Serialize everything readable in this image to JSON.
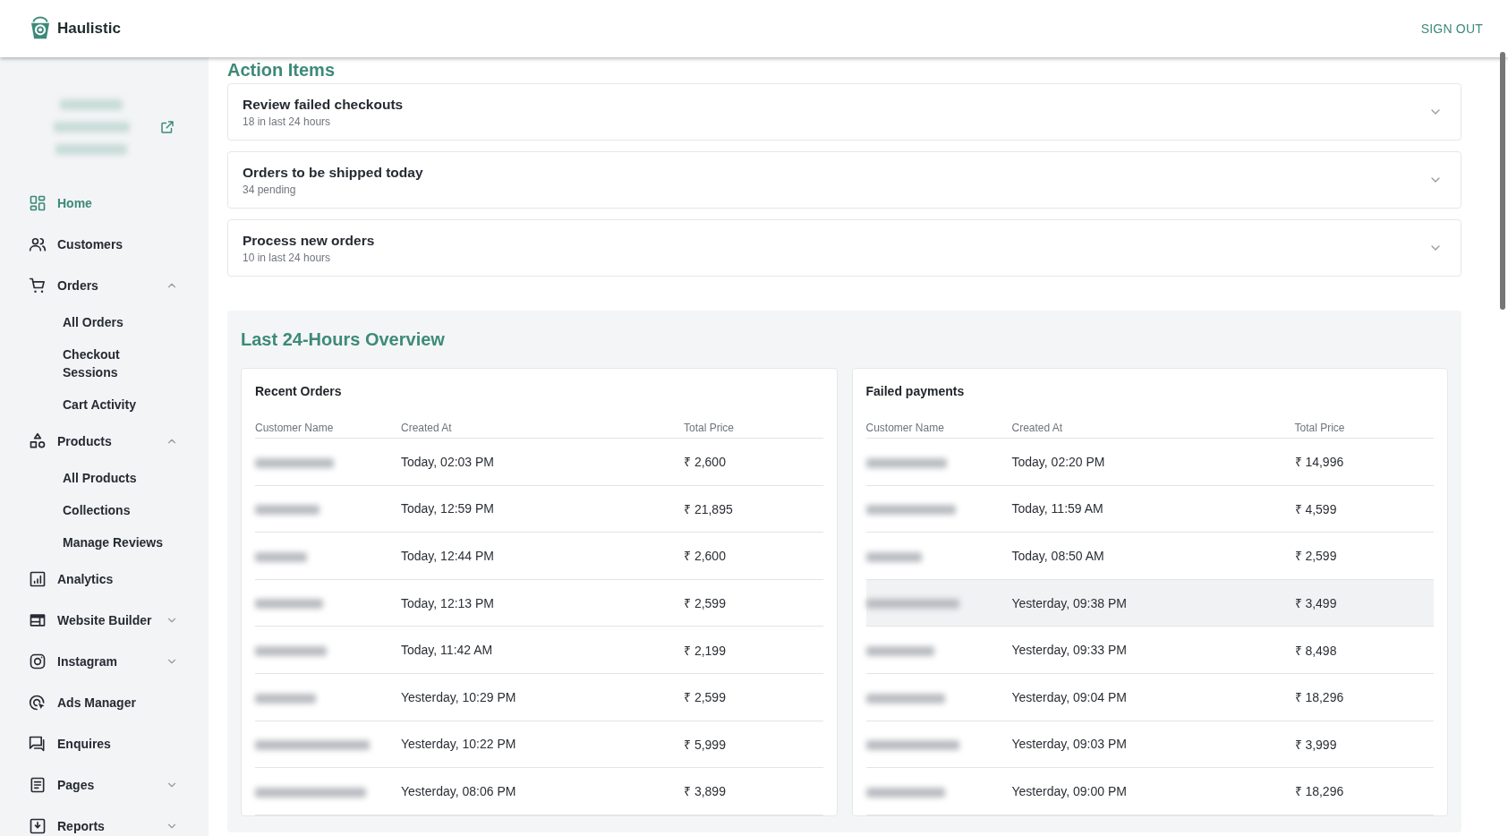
{
  "header": {
    "brand": "Haulistic",
    "sign_out": "SIGN OUT"
  },
  "sidebar": {
    "shop": {
      "kind": "blurred"
    },
    "items": [
      {
        "label": "Home",
        "selected": true
      },
      {
        "label": "Customers",
        "selected": false
      },
      {
        "label": "Orders",
        "selected": false,
        "expanded": true,
        "children": [
          {
            "label": "All Orders",
            "selected": false
          },
          {
            "label": "Checkout Sessions",
            "selected": false
          },
          {
            "label": "Cart Activity",
            "selected": false
          }
        ]
      },
      {
        "label": "Products",
        "selected": false,
        "expanded": true,
        "children": [
          {
            "label": "All Products",
            "selected": false
          },
          {
            "label": "Collections",
            "selected": false
          },
          {
            "label": "Manage Reviews",
            "selected": false
          }
        ]
      },
      {
        "label": "Analytics",
        "selected": false
      },
      {
        "label": "Website Builder",
        "selected": false,
        "expanded": false
      },
      {
        "label": "Instagram",
        "selected": false,
        "expanded": false
      },
      {
        "label": "Ads Manager",
        "selected": false
      },
      {
        "label": "Enquires",
        "selected": false
      },
      {
        "label": "Pages",
        "selected": false,
        "expanded": false
      },
      {
        "label": "Reports",
        "selected": false,
        "expanded": false
      }
    ]
  },
  "action_items": {
    "title": "Action Items",
    "items": [
      {
        "title": "Review failed checkouts",
        "subtitle": "18 in last 24 hours",
        "expanded": false
      },
      {
        "title": "Orders to be shipped today",
        "subtitle": "34 pending",
        "expanded": false
      },
      {
        "title": "Process new orders",
        "subtitle": "10 in last 24 hours",
        "expanded": false
      }
    ]
  },
  "overview": {
    "title": "Last 24-Hours Overview",
    "tables": [
      {
        "title": "Recent Orders",
        "columns": [
          "Customer Name",
          "Created At",
          "Total Price"
        ],
        "rows": [
          {
            "customer": {
              "kind": "blurred"
            },
            "created_at": "Today, 02:03 PM",
            "total_price": "₹ 2,600",
            "highlighted": false
          },
          {
            "customer": {
              "kind": "blurred"
            },
            "created_at": "Today, 12:59 PM",
            "total_price": "₹ 21,895",
            "highlighted": false
          },
          {
            "customer": {
              "kind": "blurred"
            },
            "created_at": "Today, 12:44 PM",
            "total_price": "₹ 2,600",
            "highlighted": false
          },
          {
            "customer": {
              "kind": "blurred"
            },
            "created_at": "Today, 12:13 PM",
            "total_price": "₹ 2,599",
            "highlighted": false
          },
          {
            "customer": {
              "kind": "blurred"
            },
            "created_at": "Today, 11:42 AM",
            "total_price": "₹ 2,199",
            "highlighted": false
          },
          {
            "customer": {
              "kind": "blurred"
            },
            "created_at": "Yesterday, 10:29 PM",
            "total_price": "₹ 2,599",
            "highlighted": false
          },
          {
            "customer": {
              "kind": "blurred"
            },
            "created_at": "Yesterday, 10:22 PM",
            "total_price": "₹ 5,999",
            "highlighted": false
          },
          {
            "customer": {
              "kind": "blurred"
            },
            "created_at": "Yesterday, 08:06 PM",
            "total_price": "₹ 3,899",
            "highlighted": false
          }
        ]
      },
      {
        "title": "Failed payments",
        "columns": [
          "Customer Name",
          "Created At",
          "Total Price"
        ],
        "rows": [
          {
            "customer": {
              "kind": "blurred"
            },
            "created_at": "Today, 02:20 PM",
            "total_price": "₹ 14,996",
            "highlighted": false
          },
          {
            "customer": {
              "kind": "blurred"
            },
            "created_at": "Today, 11:59 AM",
            "total_price": "₹ 4,599",
            "highlighted": false
          },
          {
            "customer": {
              "kind": "blurred"
            },
            "created_at": "Today, 08:50 AM",
            "total_price": "₹ 2,599",
            "highlighted": false
          },
          {
            "customer": {
              "kind": "blurred"
            },
            "created_at": "Yesterday, 09:38 PM",
            "total_price": "₹ 3,499",
            "highlighted": true
          },
          {
            "customer": {
              "kind": "blurred"
            },
            "created_at": "Yesterday, 09:33 PM",
            "total_price": "₹ 8,498",
            "highlighted": false
          },
          {
            "customer": {
              "kind": "blurred"
            },
            "created_at": "Yesterday, 09:04 PM",
            "total_price": "₹ 18,296",
            "highlighted": false
          },
          {
            "customer": {
              "kind": "blurred"
            },
            "created_at": "Yesterday, 09:03 PM",
            "total_price": "₹ 3,999",
            "highlighted": false
          },
          {
            "customer": {
              "kind": "blurred"
            },
            "created_at": "Yesterday, 09:00 PM",
            "total_price": "₹ 18,296",
            "highlighted": false
          }
        ]
      }
    ]
  }
}
